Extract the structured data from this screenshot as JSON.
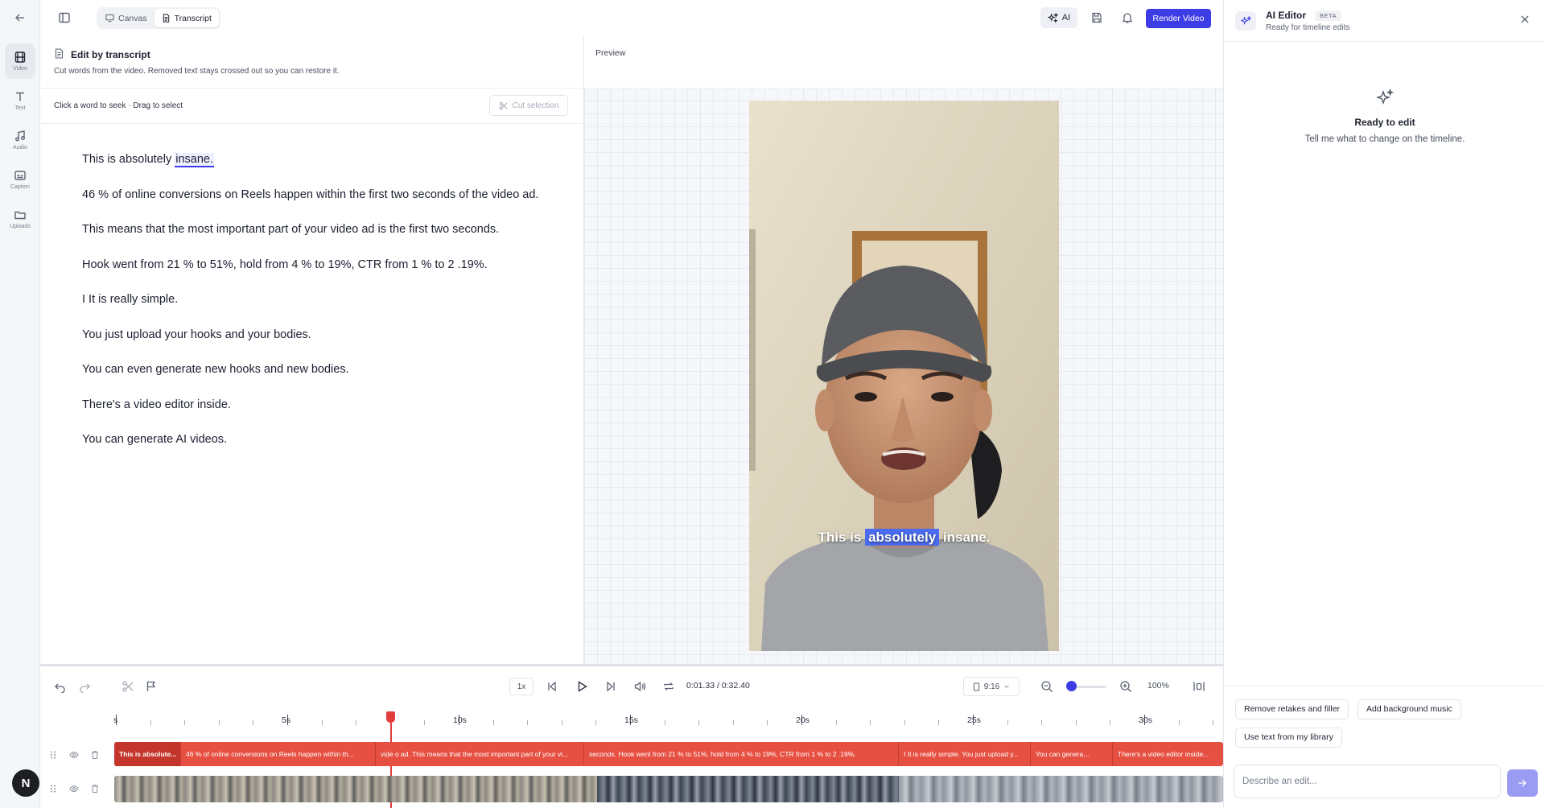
{
  "topbar": {
    "tabs": [
      {
        "label": "Canvas",
        "active": false
      },
      {
        "label": "Transcript",
        "active": true
      }
    ],
    "ai_label": "AI",
    "render_label": "Render Video",
    "accent_color": "#3d3de6"
  },
  "rail": {
    "items": [
      {
        "label": "Video",
        "icon": "film-icon",
        "active": true
      },
      {
        "label": "Text",
        "icon": "text-icon",
        "active": false
      },
      {
        "label": "Audio",
        "icon": "music-icon",
        "active": false
      },
      {
        "label": "Caption",
        "icon": "caption-icon",
        "active": false
      },
      {
        "label": "Uploads",
        "icon": "folder-icon",
        "active": false
      }
    ],
    "avatar_initial": "N"
  },
  "transcript": {
    "title": "Edit by transcript",
    "subtitle": "Cut words from the video. Removed text stays crossed out so you can restore it.",
    "hint": "Click a word to seek · Drag to select",
    "cut_label": "Cut selection",
    "highlighted_word": "insane.",
    "first_line_prefix": "This is absolutely ",
    "paragraphs": [
      "46 % of online conversions on Reels happen within the first two seconds of the video ad.",
      "This means that the most important part of your video ad is the first two seconds.",
      "Hook went from 21 % to 51%, hold from 4 % to 19%, CTR from 1 % to 2 .19%.",
      "I It is really simple.",
      "You just upload your hooks and your bodies.",
      "You can even generate new hooks and new bodies.",
      "There's a video editor inside.",
      "You can generate AI videos."
    ]
  },
  "preview": {
    "label": "Preview",
    "caption_before": "This is",
    "caption_highlight": "absolutely",
    "caption_after": "insane."
  },
  "timeline": {
    "speed": "1x",
    "current_time": "0:01.33",
    "total_time": "0:32.40",
    "timecode": "0:01.33 / 0:32.40",
    "aspect_ratio": "9:16",
    "zoom": "100%",
    "zoom_level": 0.0,
    "ruler_labels": [
      "s",
      "5s",
      "10s",
      "15s",
      "20s",
      "25s",
      "30s"
    ],
    "caption_segments": [
      "This is absolute...",
      "46 % of online conversions on Reels happen within th...",
      "vide o ad. This means that the most important part of your vi...",
      "seconds. Hook went from 21 % to 51%, hold from 4 % to 19%, CTR from 1 % to 2 .19%.",
      "I It is really simple. You just upload y...",
      "You can genera...",
      "There's a video editor inside..."
    ],
    "caption_color": "#e65042"
  },
  "ai_editor": {
    "title": "AI Editor",
    "badge": "BETA",
    "status": "Ready for timeline edits",
    "empty_title": "Ready to edit",
    "empty_subtitle": "Tell me what to change on the timeline.",
    "suggestions": [
      "Remove retakes and filler",
      "Add background music",
      "Use text from my library"
    ],
    "input_placeholder": "Describe an edit..."
  }
}
